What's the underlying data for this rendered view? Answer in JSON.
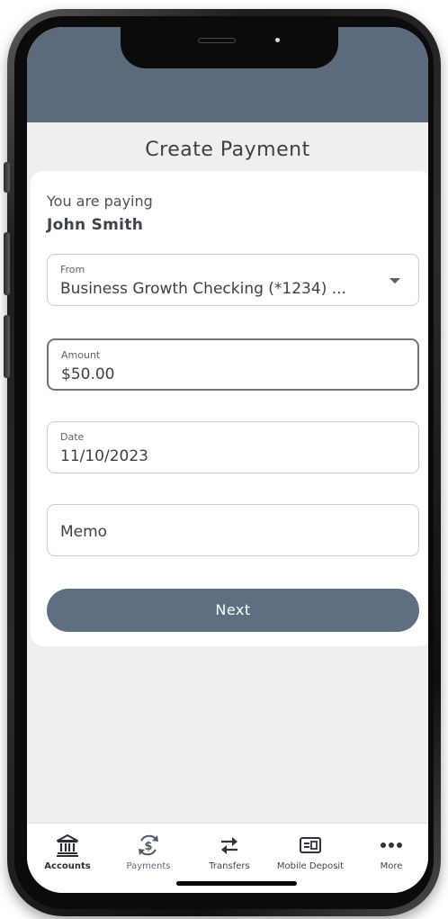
{
  "header": {
    "title": "Create Payment"
  },
  "payee": {
    "label": "You are paying",
    "name": "John Smith"
  },
  "form": {
    "from": {
      "label": "From",
      "value": "Business Growth Checking (*1234) ..."
    },
    "amount": {
      "label": "Amount",
      "value": "$50.00"
    },
    "date": {
      "label": "Date",
      "value": "11/10/2023"
    },
    "memo": {
      "placeholder": "Memo"
    },
    "next_label": "Next"
  },
  "tabbar": {
    "items": [
      {
        "label": "Accounts",
        "icon": "bank-icon",
        "active": true
      },
      {
        "label": "Payments",
        "icon": "payment-refresh-icon"
      },
      {
        "label": "Transfers",
        "icon": "transfer-arrows-icon"
      },
      {
        "label": "Mobile Deposit",
        "icon": "check-deposit-icon"
      },
      {
        "label": "More",
        "icon": "more-dots-icon"
      }
    ]
  },
  "colors": {
    "header_bar": "#5c6b7c",
    "primary_button": "#5f6f82",
    "background": "#efefef",
    "text": "#3c4149"
  }
}
